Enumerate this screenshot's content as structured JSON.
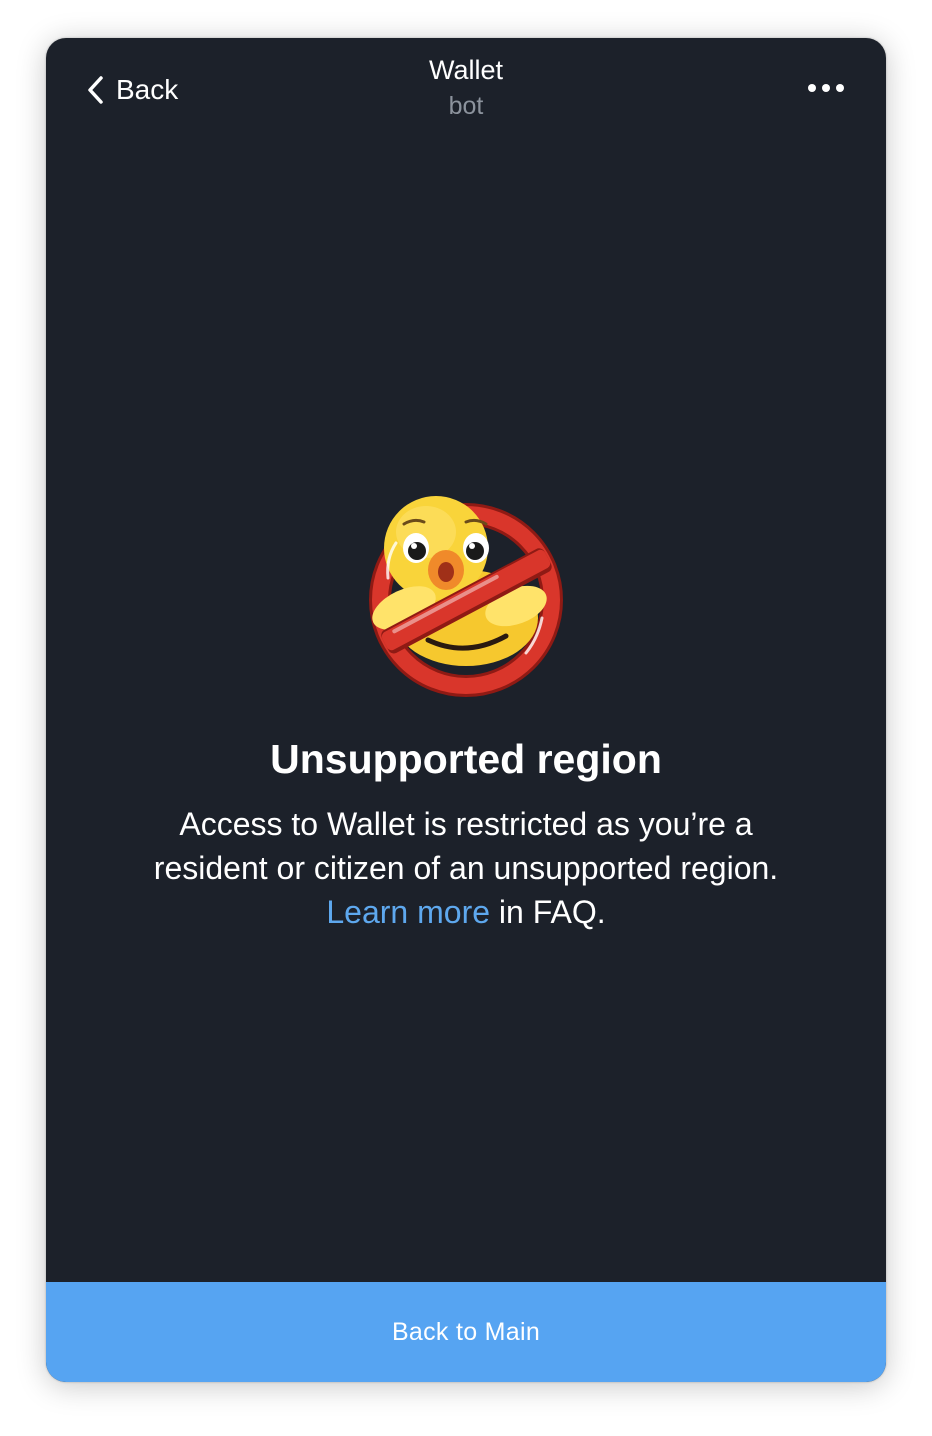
{
  "header": {
    "back_label": "Back",
    "title": "Wallet",
    "subtitle": "bot"
  },
  "main": {
    "sticker_icon": "duck-prohibited-icon",
    "headline": "Unsupported region",
    "description_line1": "Access to Wallet is restricted as you’re a",
    "description_line2": "resident or citizen of an unsupported region.",
    "link_text": "Learn more",
    "link_suffix": " in FAQ."
  },
  "footer": {
    "button_label": "Back to Main"
  },
  "colors": {
    "background": "#1c212a",
    "accent": "#56a4f2",
    "link": "#5ea8ee",
    "subtitle": "#8c939d"
  }
}
